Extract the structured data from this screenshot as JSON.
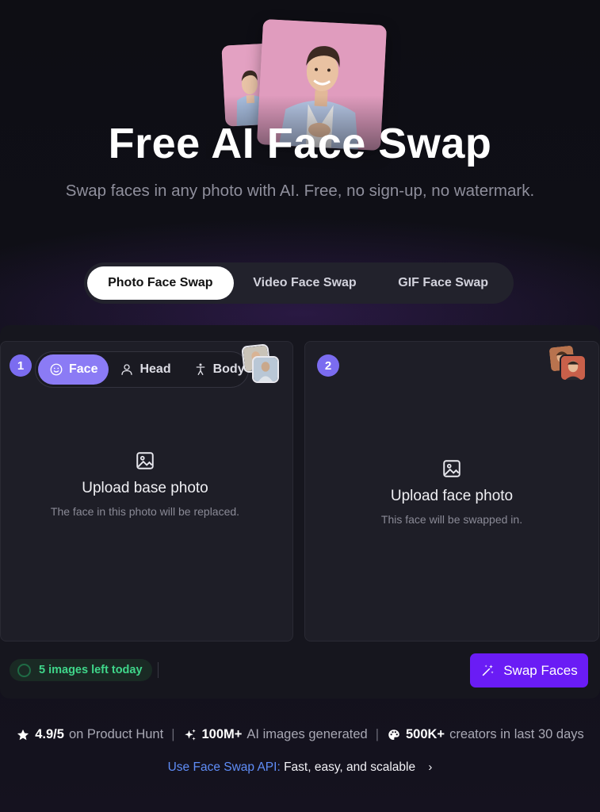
{
  "hero": {
    "title": "Free AI Face Swap",
    "subtitle": "Swap faces in any photo with AI. Free, no sign-up, no watermark."
  },
  "mode_tabs": {
    "photo": "Photo Face Swap",
    "video": "Video Face Swap",
    "gif": "GIF Face Swap",
    "active": "photo"
  },
  "base_panel": {
    "step": "1",
    "targets": {
      "face": "Face",
      "head": "Head",
      "body": "Body",
      "active": "face"
    },
    "upload_title": "Upload base photo",
    "upload_desc": "The face in this photo will be replaced."
  },
  "face_panel": {
    "step": "2",
    "upload_title": "Upload face photo",
    "upload_desc": "This face will be swapped in."
  },
  "quota": {
    "label": "5 images left today"
  },
  "swap_button": {
    "label": "Swap Faces"
  },
  "stats": {
    "rating_value": "4.9/5",
    "rating_text": "on Product Hunt",
    "images_value": "100M+",
    "images_text": "AI images generated",
    "creators_value": "500K+",
    "creators_text": "creators in last 30 days"
  },
  "api": {
    "label": "Use Face Swap API:",
    "text": "Fast, easy, and scalable"
  },
  "colors": {
    "accent": "#6a1cf5",
    "toggle_active": "#8b7bf5",
    "quota_green": "#3fd68a",
    "link_blue": "#5f8df7"
  }
}
